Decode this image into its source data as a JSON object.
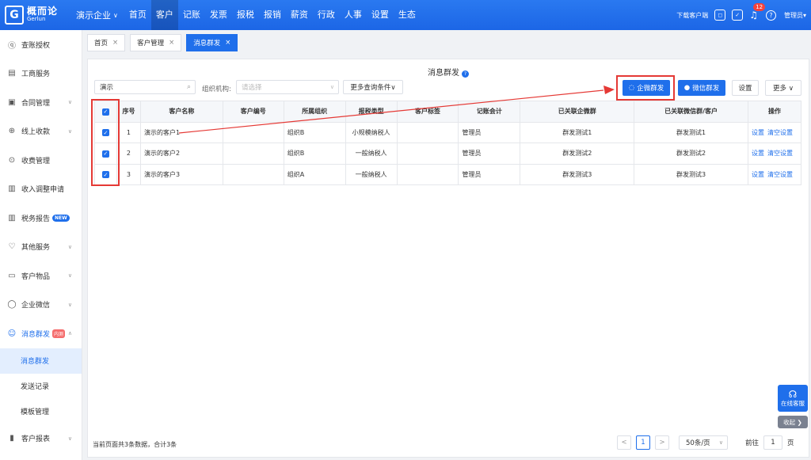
{
  "brand": {
    "logo_mark": "G",
    "name_cn": "概而论",
    "name_en": "Gerlun"
  },
  "company": {
    "name": "演示企业",
    "chevron": "∨"
  },
  "nav": [
    "首页",
    "客户",
    "记账",
    "发票",
    "报税",
    "报销",
    "薪资",
    "行政",
    "人事",
    "设置",
    "生态"
  ],
  "nav_active_index": 1,
  "topright": {
    "download": "下载客户端",
    "notification_count": "12",
    "user": "管理员▾"
  },
  "sidebar": {
    "items": [
      {
        "icon": "user-icon",
        "glyph": "ⓠ",
        "label": "查账授权"
      },
      {
        "icon": "id-card-icon",
        "glyph": "▤",
        "label": "工商服务"
      },
      {
        "icon": "contract-icon",
        "glyph": "▣",
        "label": "合同管理",
        "arrow": "∨"
      },
      {
        "icon": "coin-icon",
        "glyph": "⊕",
        "label": "线上收款",
        "arrow": "∨"
      },
      {
        "icon": "fee-icon",
        "glyph": "⊙",
        "label": "收费管理"
      },
      {
        "icon": "doc-icon",
        "glyph": "▥",
        "label": "收入调整申请"
      },
      {
        "icon": "report-icon",
        "glyph": "▥",
        "label": "税务报告",
        "tag": "NEW"
      },
      {
        "icon": "heart-icon",
        "glyph": "♡",
        "label": "其他服务",
        "arrow": "∨"
      },
      {
        "icon": "box-icon",
        "glyph": "▭",
        "label": "客户物品",
        "arrow": "∨"
      },
      {
        "icon": "chat-icon",
        "glyph": "◯",
        "label": "企业微信",
        "arrow": "∨"
      }
    ],
    "active_group": {
      "icon": "bot-icon",
      "glyph": "☺",
      "label": "消息群发",
      "tag": "内测",
      "arrow": "∧"
    },
    "sub_items": [
      "消息群发",
      "发送记录",
      "模板管理"
    ],
    "bottom_item": {
      "icon": "chart-icon",
      "glyph": "▮",
      "label": "客户报表",
      "arrow": "∨"
    }
  },
  "tabs": [
    {
      "label": "首页",
      "close": "×"
    },
    {
      "label": "客户管理",
      "close": "×"
    },
    {
      "label": "消息群发",
      "close": "×"
    }
  ],
  "panel": {
    "title": "消息群发",
    "help": "?",
    "search_value": "演示",
    "org_label": "组织机构:",
    "org_placeholder": "请选择",
    "more_query": "更多查询条件∨",
    "buttons": {
      "wecom": "企微群发",
      "wechat": "微信群发",
      "settings": "设置",
      "more": "更多 ∨"
    }
  },
  "table": {
    "headers": [
      "",
      "序号",
      "客户名称",
      "客户编号",
      "所属组织",
      "报税类型",
      "客户标签",
      "记账会计",
      "已关联企微群",
      "已关联微信群/客户",
      "操作"
    ],
    "rows": [
      {
        "no": "1",
        "name": "演示的客户1",
        "code": "",
        "org": "组织B",
        "tax": "小规模纳税人",
        "tag": "",
        "acct": "管理员",
        "wecom": "群发测试1",
        "wechat": "群发测试1",
        "op1": "设置",
        "op2": "清空设置"
      },
      {
        "no": "2",
        "name": "演示的客户2",
        "code": "",
        "org": "组织B",
        "tax": "一般纳税人",
        "tag": "",
        "acct": "管理员",
        "wecom": "群发测试2",
        "wechat": "群发测试2",
        "op1": "设置",
        "op2": "清空设置"
      },
      {
        "no": "3",
        "name": "演示的客户3",
        "code": "",
        "org": "组织A",
        "tax": "一般纳税人",
        "tag": "",
        "acct": "管理员",
        "wecom": "群发测试3",
        "wechat": "群发测试3",
        "op1": "设置",
        "op2": "清空设置"
      }
    ]
  },
  "footer": {
    "summary": "当前页面共3条数据，合计3条",
    "prev": "<",
    "page": "1",
    "next": ">",
    "page_size": "50条/页",
    "goto_label": "前往",
    "goto_value": "1",
    "goto_unit": "页"
  },
  "floating": {
    "service": "在线客服",
    "collapse": "收起 ❯"
  },
  "colors": {
    "primary": "#1f6feb",
    "annotation": "#e53935"
  }
}
